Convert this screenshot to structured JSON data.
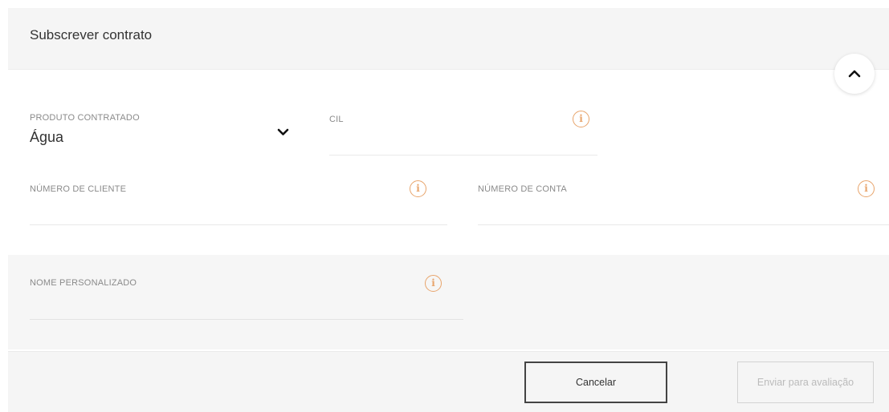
{
  "header": {
    "title": "Subscrever contrato",
    "collapse_icon": "chevron-up-icon"
  },
  "fields": {
    "produto": {
      "label": "PRODUTO CONTRATADO",
      "value": "Água",
      "icon": "chevron-down-icon"
    },
    "cil": {
      "label": "CIL",
      "value": "",
      "icon": "info-icon"
    },
    "numero_cliente": {
      "label": "NÚMERO DE CLIENTE",
      "value": "",
      "icon": "info-icon"
    },
    "numero_conta": {
      "label": "NÚMERO DE CONTA",
      "value": "",
      "icon": "info-icon"
    },
    "nome_personalizado": {
      "label": "NOME PERSONALIZADO",
      "value": "",
      "icon": "info-icon"
    }
  },
  "footer": {
    "cancel_label": "Cancelar",
    "submit_label": "Enviar para avaliação"
  },
  "colors": {
    "accent": "#e8a46b",
    "header_bg": "#f5f5f5",
    "border_dark": "#444444",
    "disabled_text": "#bbbbbb"
  }
}
